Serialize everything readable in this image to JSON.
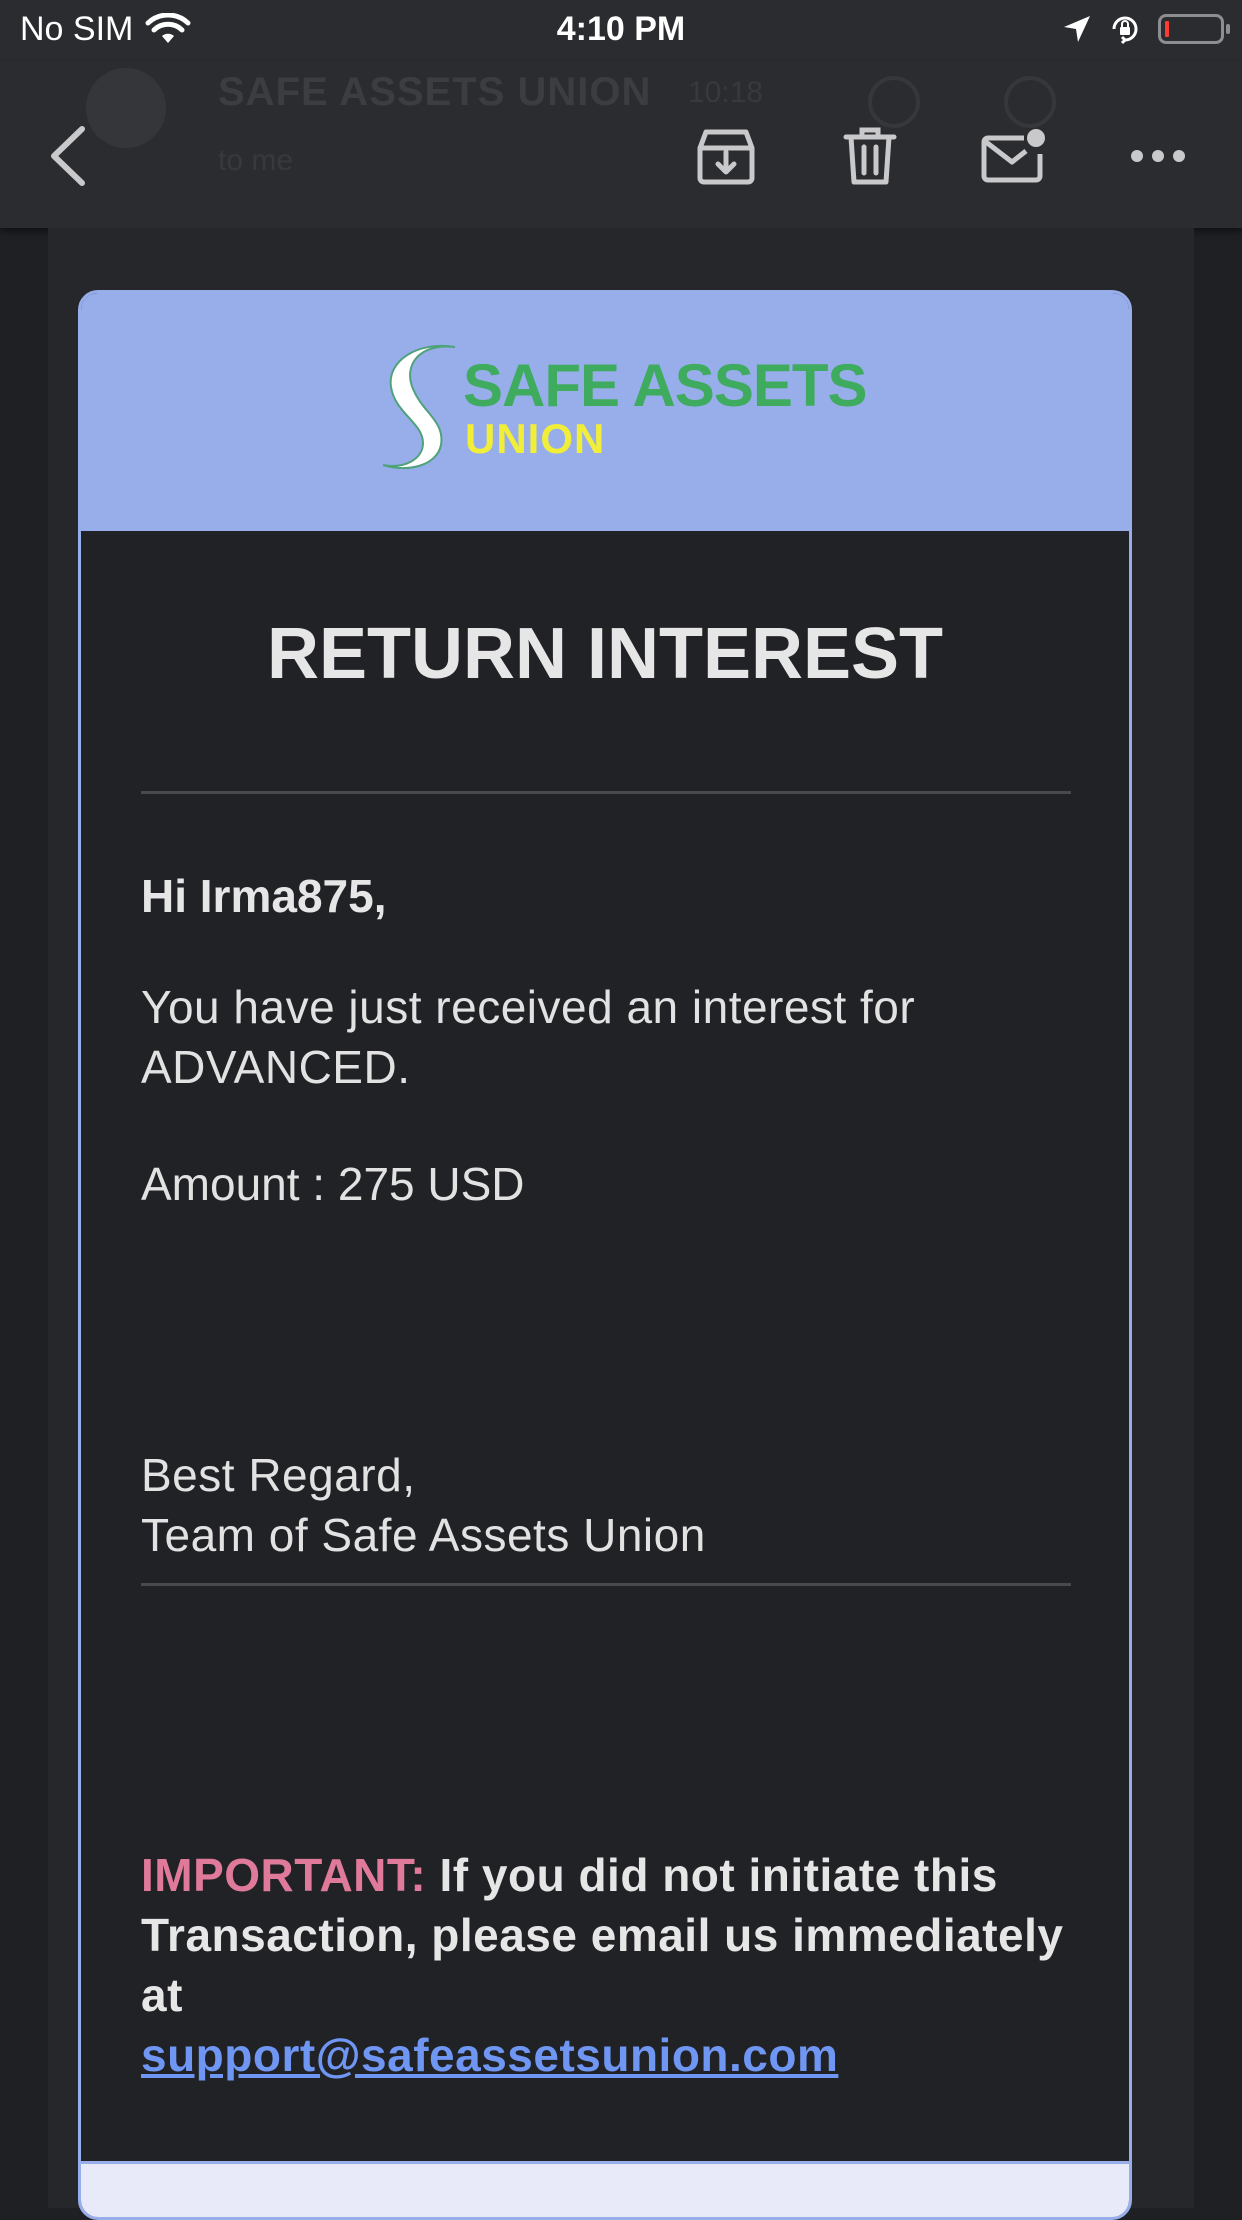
{
  "status_bar": {
    "carrier": "No SIM",
    "time": "4:10 PM"
  },
  "toolbar": {
    "sender": "SAFE ASSETS UNION",
    "date": "10:18",
    "to": "to me",
    "actions": [
      "back",
      "archive",
      "delete",
      "mark-unread",
      "more"
    ]
  },
  "email": {
    "logo": {
      "line1": "SAFE ASSETS",
      "line2": "UNION"
    },
    "title": "RETURN INTEREST",
    "greeting": "Hi Irma875,",
    "message": "You have just received an interest for ADVANCED.",
    "amount": "Amount : 275 USD",
    "sign_off": "Best Regard,",
    "team": "Team of Safe Assets Union",
    "important_label": "IMPORTANT:",
    "important_text": " If you did not initiate this Transaction, please email us immediately at ",
    "support_email": "support@safeassetsunion.com"
  },
  "colors": {
    "header_bg": "#97aeea",
    "logo_green": "#3fab5e",
    "logo_yellow": "#f1ee3a",
    "important_pink": "#e07a9a",
    "link_blue": "#6f96f3"
  }
}
